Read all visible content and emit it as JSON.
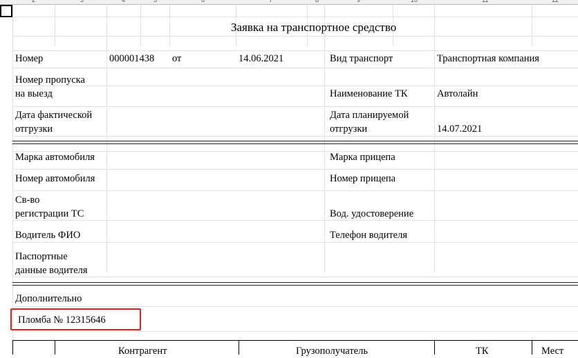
{
  "column_headers": [
    "2",
    "3",
    "4",
    "5",
    "6",
    "7",
    "8",
    "9",
    "10",
    "11",
    "12"
  ],
  "form": {
    "title": "Заявка на транспортное средство",
    "number_label": "Номер",
    "number_value": "000001438",
    "from_label": "от",
    "date_value": "14.06.2021",
    "transport_type_label": "Вид транспорт",
    "transport_type_value": "Транспортная компания",
    "pass_label_1": "Номер пропуска",
    "pass_label_2": "на выезд",
    "tk_name_label": "Наименование ТК",
    "tk_name_value": "Автолайн",
    "actual_ship_label_1": "Дата фактической",
    "actual_ship_label_2": "отгрузки",
    "planned_ship_label_1": "Дата планируемой",
    "planned_ship_label_2": "отгрузки",
    "planned_ship_value": "14.07.2021",
    "car_brand_label": "Марка автомобиля",
    "trailer_brand_label": "Марка прицепа",
    "car_number_label": "Номер автомобиля",
    "trailer_number_label": "Номер прицепа",
    "reg_label_1": "Св-во",
    "reg_label_2": "регистрации ТС",
    "license_label": "Вод. удостоверение",
    "driver_label": "Водитель ФИО",
    "driver_phone_label": "Телефон водителя",
    "passport_label_1": "Паспортные",
    "passport_label_2": "данные водителя",
    "extra_label": "Дополнительно",
    "seal_text": "Пломба № 12315646"
  },
  "table": {
    "headers": [
      "Контрагент",
      "Грузополучатель",
      "ТК",
      "Мест"
    ]
  }
}
